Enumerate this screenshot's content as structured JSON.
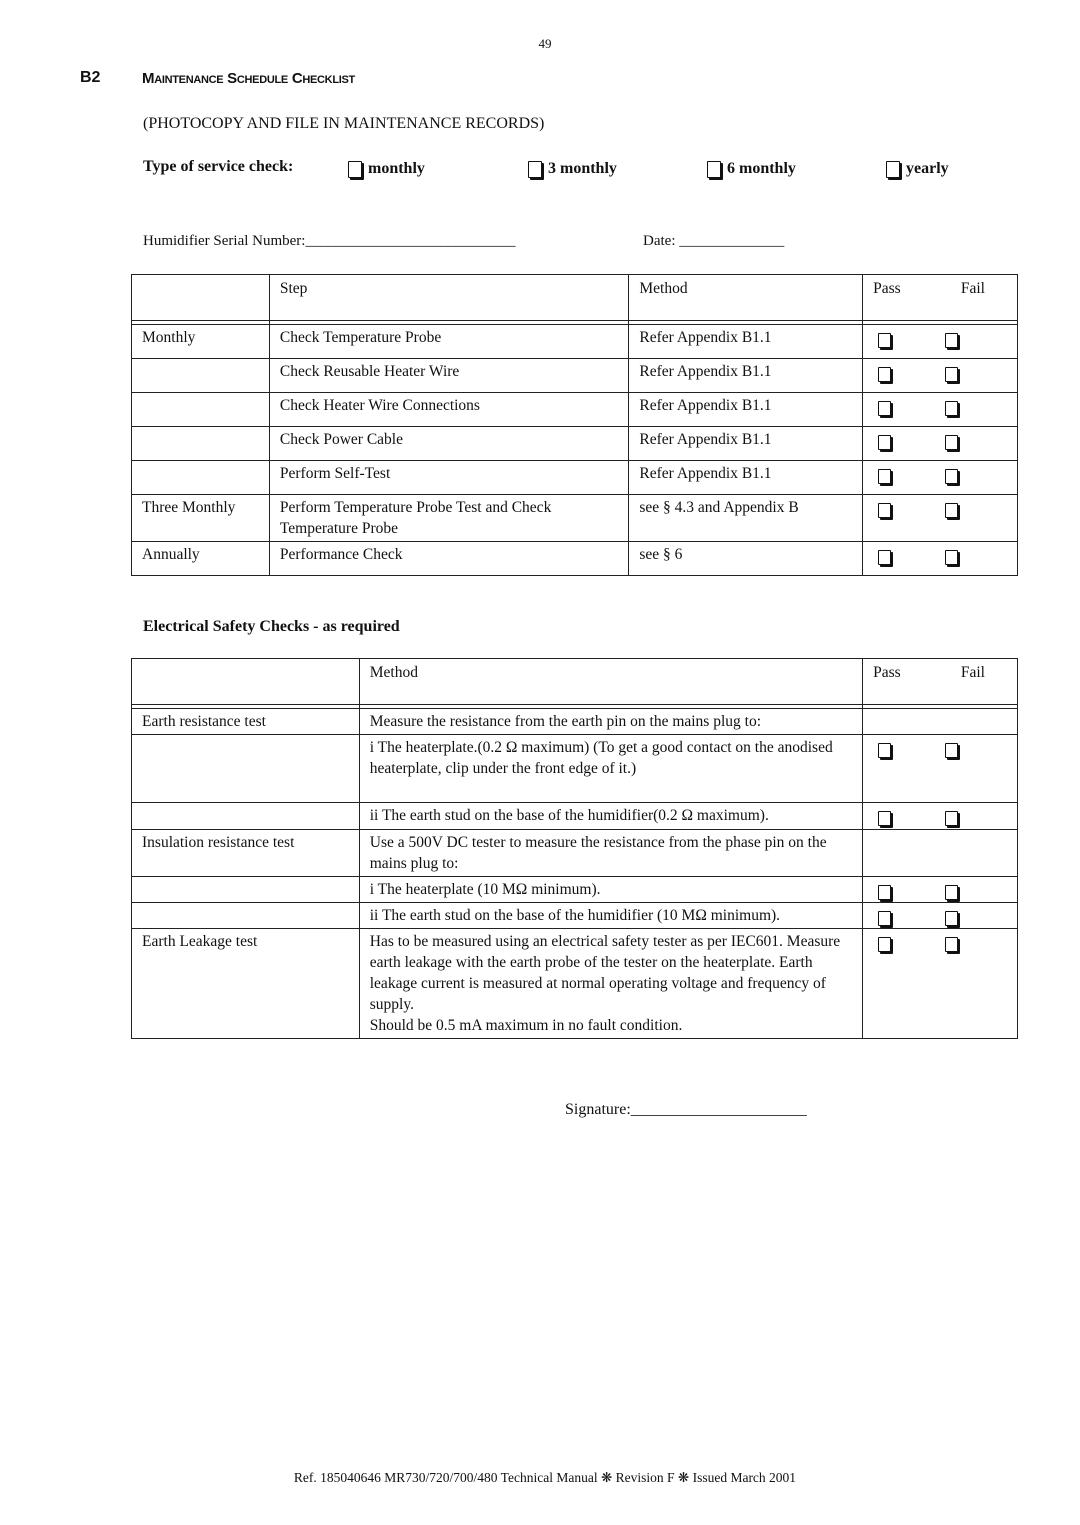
{
  "page_number": "49",
  "section": {
    "number": "B2",
    "title": "Maintenance Schedule Checklist"
  },
  "instruction": "(PHOTOCOPY AND FILE IN MAINTENANCE RECORDS)",
  "service_check": {
    "label": "Type of service check:",
    "options": [
      "monthly",
      "3 monthly",
      "6 monthly",
      "yearly"
    ]
  },
  "serial_field": "Humidifier Serial Number:____________________________",
  "date_field": "Date:  ______________",
  "schedule_table": {
    "headers": [
      "",
      "Step",
      "Method",
      "Pass",
      "Fail"
    ],
    "rows": [
      {
        "interval": "Monthly",
        "step": "Check Temperature Probe",
        "method": "Refer Appendix B1.1"
      },
      {
        "interval": "",
        "step": "Check Reusable Heater Wire",
        "method": "Refer Appendix B1.1"
      },
      {
        "interval": "",
        "step": "Check Heater Wire Connections",
        "method": "Refer Appendix B1.1"
      },
      {
        "interval": "",
        "step": "Check Power Cable",
        "method": "Refer Appendix B1.1"
      },
      {
        "interval": "",
        "step": "Perform Self-Test",
        "method": "Refer Appendix B1.1"
      },
      {
        "interval": "Three Monthly",
        "step": "Perform Temperature Probe Test and Check Temperature Probe",
        "method": "see § 4.3 and Appendix B"
      },
      {
        "interval": "Annually",
        "step": "Performance Check",
        "method": "see § 6"
      }
    ]
  },
  "electrical_title": "Electrical Safety Checks - as required",
  "electrical_table": {
    "headers": [
      "",
      "Method",
      "Pass",
      "Fail"
    ],
    "rows": [
      {
        "test": "Earth resistance test",
        "method": "Measure the resistance from the earth pin on the mains plug to:",
        "checkboxes": false
      },
      {
        "test": "",
        "method": "i The heaterplate.(0.2 Ω maximum) (To get a good contact on the anodised heaterplate, clip under the front edge of it.)",
        "checkboxes": true
      },
      {
        "test": "",
        "method": "ii The earth stud on the base of the humidifier(0.2 Ω maximum).",
        "checkboxes": true
      },
      {
        "test": "Insulation resistance test",
        "method": "Use a 500V DC tester to measure the resistance from the phase pin on the mains plug to:",
        "checkboxes": false
      },
      {
        "test": "",
        "method": "i The heaterplate (10 MΩ minimum).",
        "checkboxes": true
      },
      {
        "test": "",
        "method": "ii The earth stud on the base of the humidifier (10 MΩ minimum).",
        "checkboxes": true
      },
      {
        "test": "Earth Leakage test",
        "method": "Has to be measured using an electrical safety tester as per IEC601. Measure earth leakage with the earth probe of the tester on the heaterplate. Earth leakage current is measured at normal operating voltage and frequency of supply.\nShould be 0.5 mA maximum in no fault condition.",
        "checkboxes": true
      }
    ]
  },
  "signature_field": "Signature:______________________",
  "footer": "Ref. 185040646 MR730/720/700/480 Technical Manual ❋ Revision F ❋ Issued March 2001"
}
